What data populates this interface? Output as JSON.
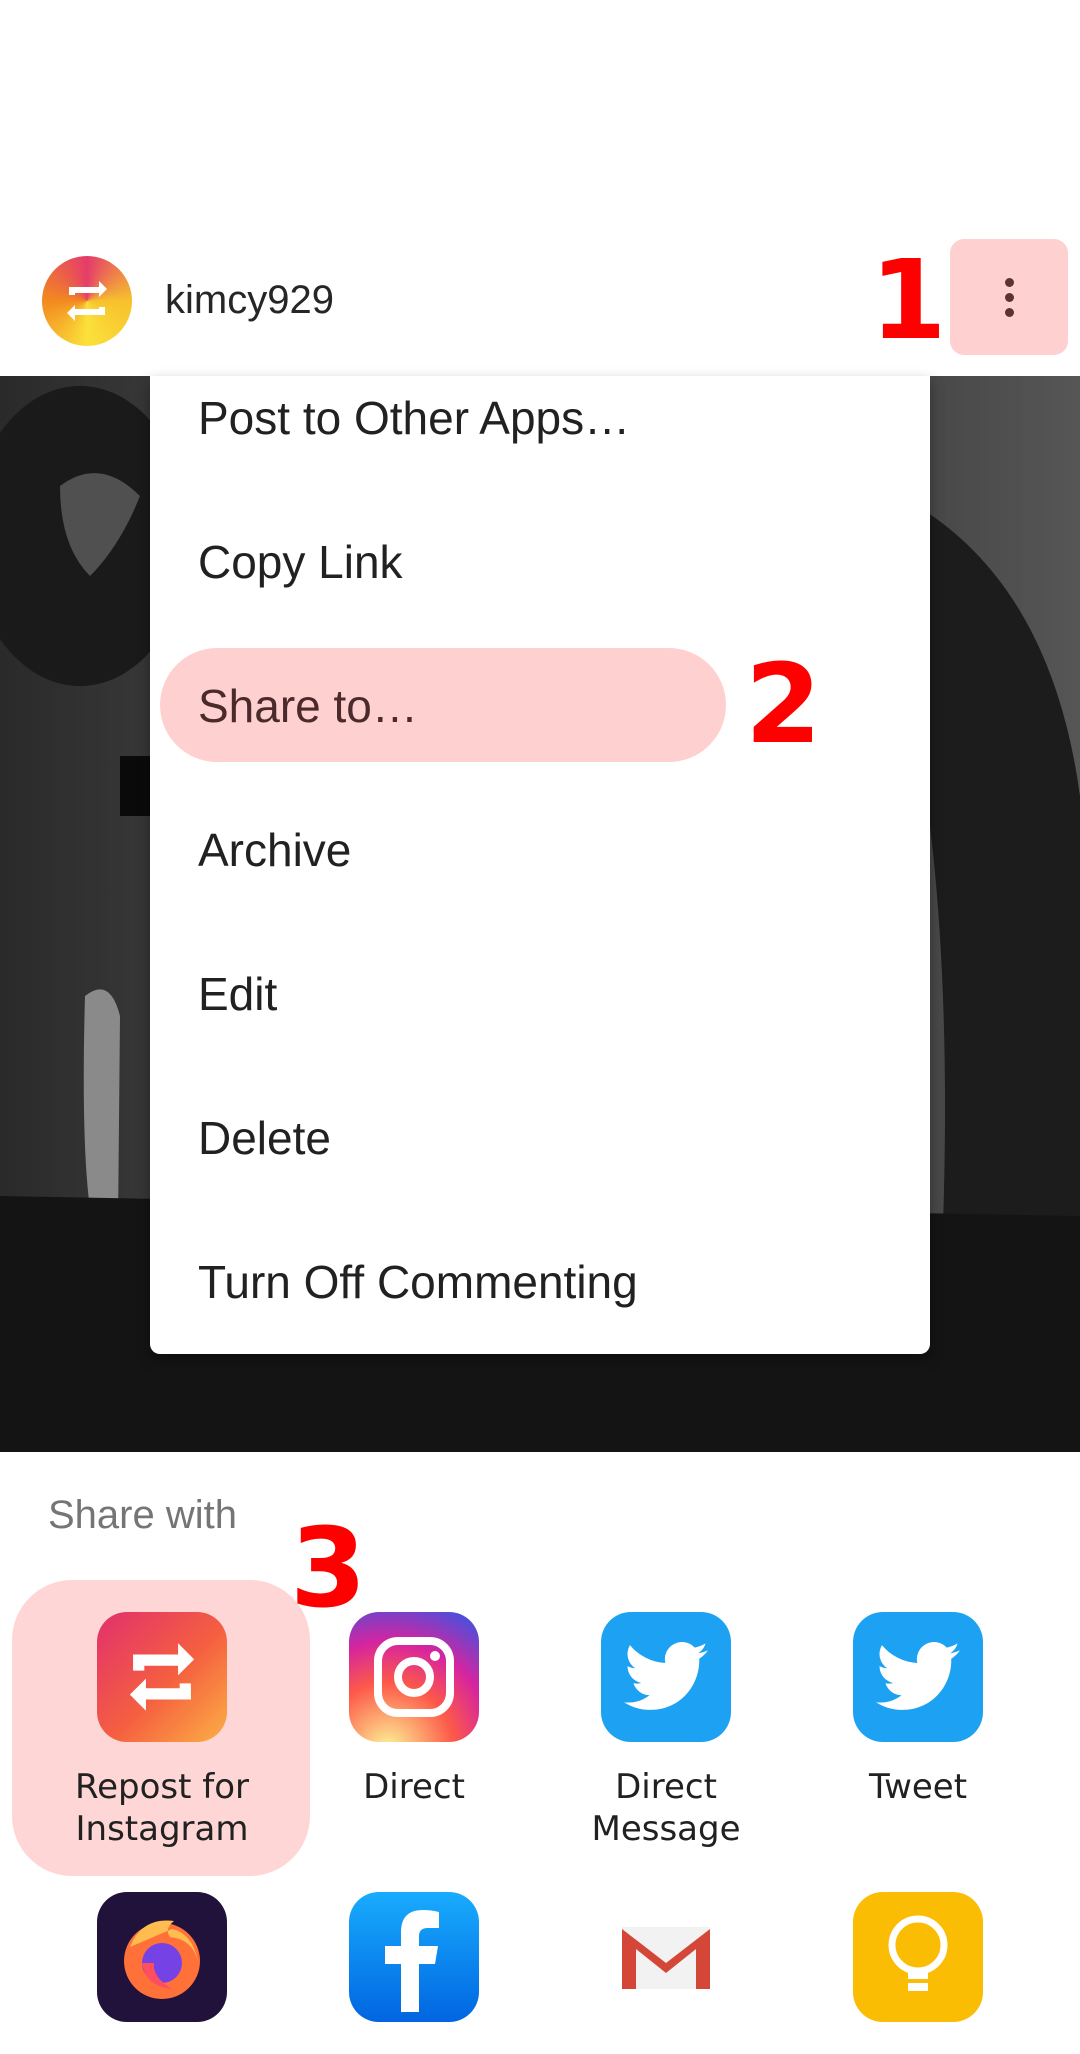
{
  "header": {
    "username": "kimcy929",
    "step1": "1"
  },
  "menu": {
    "items": [
      "Post to Other Apps…",
      "Copy Link",
      "Share to…",
      "Archive",
      "Edit",
      "Delete",
      "Turn Off Commenting"
    ],
    "step2": "2"
  },
  "share_sheet": {
    "title": "Share with",
    "step3": "3",
    "apps_row1": [
      {
        "label": "Repost for Instagram",
        "icon": "repost-icon"
      },
      {
        "label": "Direct",
        "icon": "instagram-icon"
      },
      {
        "label": "Direct Message",
        "icon": "twitter-icon"
      },
      {
        "label": "Tweet",
        "icon": "twitter-icon"
      }
    ],
    "apps_row2": [
      {
        "icon": "firefox-icon"
      },
      {
        "icon": "facebook-icon"
      },
      {
        "icon": "gmail-icon"
      },
      {
        "icon": "keep-icon"
      }
    ]
  },
  "colors": {
    "highlight": "#ffd0d0",
    "annotation": "#ff0000",
    "twitter": "#1da1f2",
    "facebook": "#1877f2",
    "keep": "#fbbc04"
  }
}
